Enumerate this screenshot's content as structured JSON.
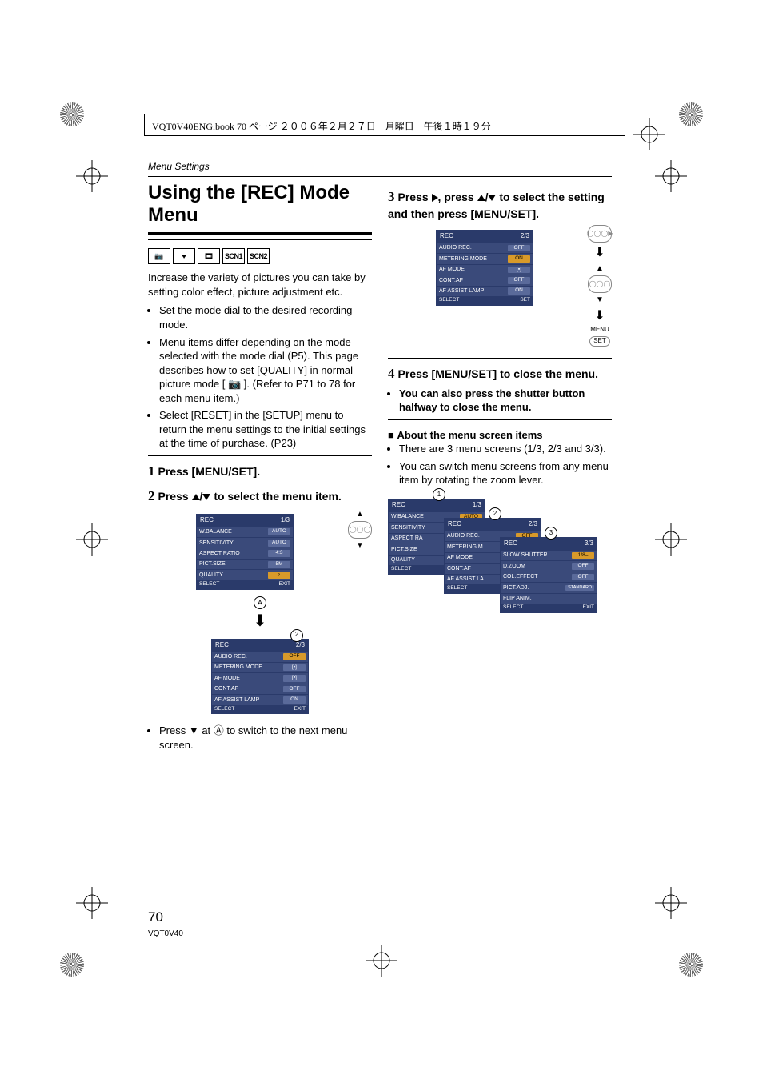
{
  "header_line": "VQT0V40ENG.book  70 ページ  ２００６年２月２７日　月曜日　午後１時１９分",
  "section_label": "Menu Settings",
  "title": "Using the [REC] Mode Menu",
  "mode_icons": [
    "📷",
    "❤",
    "🎞",
    "SCN1",
    "SCN2"
  ],
  "intro": "Increase the variety of pictures you can take by setting color effect, picture adjustment etc.",
  "bullets_left": [
    "Set the mode dial to the desired recording mode.",
    "Menu items differ depending on the mode selected with the mode dial (P5). This page describes how to set [QUALITY] in normal picture mode [ 📷 ]. (Refer to P71 to 78 for each menu item.)",
    "Select [RESET] in the [SETUP] menu to return the menu settings to the initial settings at the time of purchase. (P23)"
  ],
  "steps": {
    "s1": "Press [MENU/SET].",
    "s2": "Press ▲/▼ to select the menu item.",
    "s2_note": "Press ▼ at Ⓐ to switch to the next menu screen.",
    "s3": "Press ▶, press ▲/▼ to select the setting and then press [MENU/SET].",
    "s4": "Press [MENU/SET] to close the menu.",
    "s4_sub": "You can also press the shutter button halfway to close the menu."
  },
  "about_head": "About the menu screen items",
  "about_bullets": [
    "There are 3 menu screens (1/3, 2/3 and 3/3).",
    "You can switch menu screens from any menu item by rotating the zoom lever."
  ],
  "menu_title": "REC",
  "menu_footer_select": "SELECT",
  "menu_footer_exit": "EXIT",
  "menu_footer_set": "SET",
  "side_labels": {
    "menu": "MENU",
    "set": "SET"
  },
  "menu1": {
    "page": "1/3",
    "rows": [
      {
        "label": "W.BALANCE",
        "value": "AUTO"
      },
      {
        "label": "SENSITIVITY",
        "value": "AUTO"
      },
      {
        "label": "ASPECT RATIO",
        "value": "4:3"
      },
      {
        "label": "PICT.SIZE",
        "value": "5M"
      },
      {
        "label": "QUALITY",
        "value": "›"
      }
    ],
    "selected": 4
  },
  "menu2": {
    "page": "2/3",
    "rows": [
      {
        "label": "AUDIO REC.",
        "value": "OFF"
      },
      {
        "label": "METERING MODE",
        "value": "[•]"
      },
      {
        "label": "AF MODE",
        "value": "[▪]"
      },
      {
        "label": "CONT.AF",
        "value": "OFF"
      },
      {
        "label": "AF ASSIST LAMP",
        "value": "ON"
      }
    ],
    "selected": 0
  },
  "menu3": {
    "page": "2/3",
    "rows": [
      {
        "label": "AUDIO REC.",
        "value": "OFF"
      },
      {
        "label": "METERING MODE",
        "value": "ON"
      },
      {
        "label": "AF MODE",
        "value": "[▪]"
      },
      {
        "label": "CONT.AF",
        "value": "OFF"
      },
      {
        "label": "AF ASSIST LAMP",
        "value": "ON"
      }
    ],
    "selected": 0,
    "value_selected_idx": 1
  },
  "stack": {
    "p1": {
      "page": "1/3",
      "rows": [
        {
          "label": "W.BALANCE",
          "value": "AUTO"
        },
        {
          "label": "SENSITIVITY",
          "value": ""
        },
        {
          "label": "ASPECT RA",
          "value": ""
        },
        {
          "label": "PICT.SIZE",
          "value": ""
        },
        {
          "label": "QUALITY",
          "value": ""
        }
      ]
    },
    "p2": {
      "page": "2/3",
      "rows": [
        {
          "label": "AUDIO REC.",
          "value": "OFF"
        },
        {
          "label": "METERING M",
          "value": ""
        },
        {
          "label": "AF MODE",
          "value": ""
        },
        {
          "label": "CONT.AF",
          "value": ""
        },
        {
          "label": "AF ASSIST LA",
          "value": ""
        }
      ]
    },
    "p3": {
      "page": "3/3",
      "rows": [
        {
          "label": "SLOW SHUTTER",
          "value": "1/8–"
        },
        {
          "label": "D.ZOOM",
          "value": "OFF"
        },
        {
          "label": "COL.EFFECT",
          "value": "OFF"
        },
        {
          "label": "PICT.ADJ.",
          "value": "STANDARD"
        },
        {
          "label": "FLIP ANIM.",
          "value": ""
        }
      ]
    }
  },
  "page_number": "70",
  "page_code": "VQT0V40"
}
